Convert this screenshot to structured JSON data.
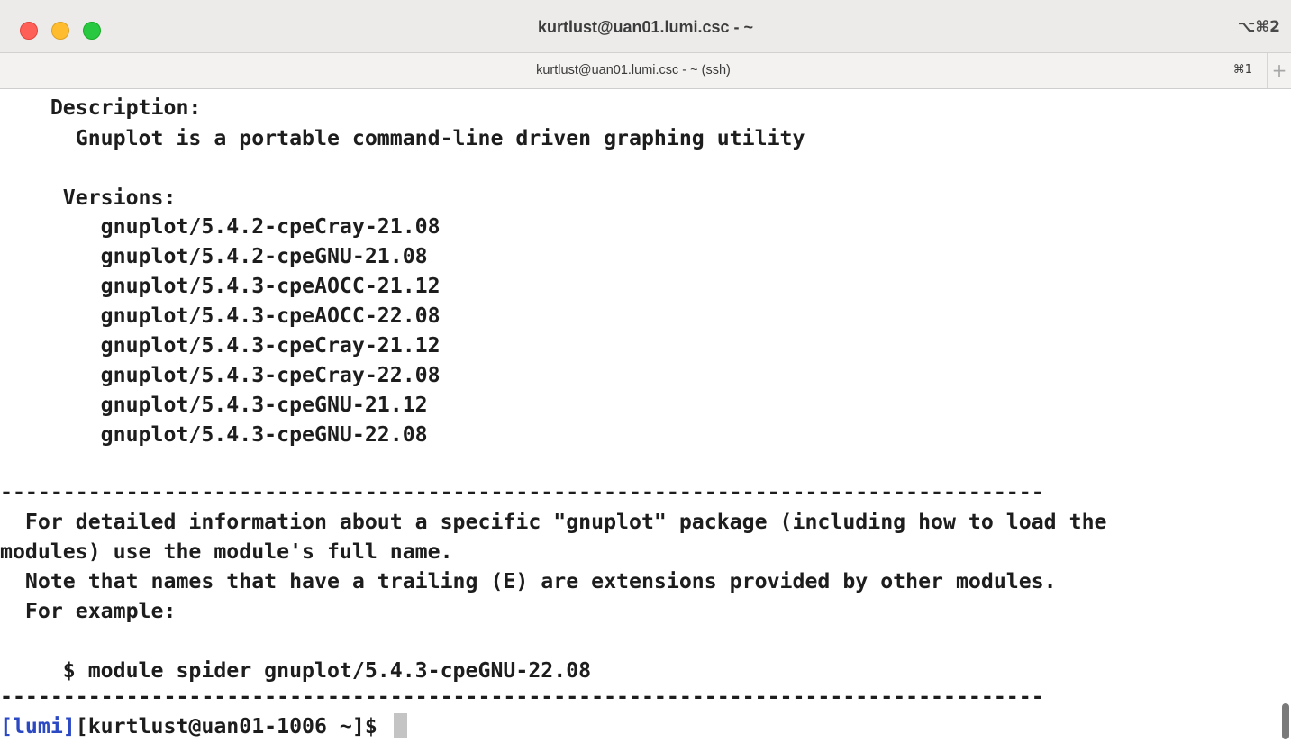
{
  "window": {
    "title": "kurtlust@uan01.lumi.csc - ~",
    "shortcut": "⌥⌘2"
  },
  "tab": {
    "title": "kurtlust@uan01.lumi.csc - ~ (ssh)",
    "shortcut": "⌘1",
    "new_tab": "+"
  },
  "terminal": {
    "description_header": "    Description:",
    "description_text": "      Gnuplot is a portable command-line driven graphing utility",
    "versions_header": "     Versions:",
    "versions": [
      "        gnuplot/5.4.2-cpeCray-21.08",
      "        gnuplot/5.4.2-cpeGNU-21.08",
      "        gnuplot/5.4.3-cpeAOCC-21.12",
      "        gnuplot/5.4.3-cpeAOCC-22.08",
      "        gnuplot/5.4.3-cpeCray-21.12",
      "        gnuplot/5.4.3-cpeCray-22.08",
      "        gnuplot/5.4.3-cpeGNU-21.12",
      "        gnuplot/5.4.3-cpeGNU-22.08"
    ],
    "separator": "-----------------------------------------------------------------------------------",
    "info_lines": [
      "  For detailed information about a specific \"gnuplot\" package (including how to load the",
      "modules) use the module's full name.",
      "  Note that names that have a trailing (E) are extensions provided by other modules.",
      "  For example:"
    ],
    "example_command": "     $ module spider gnuplot/5.4.3-cpeGNU-22.08",
    "prompt_tag": "[lumi]",
    "prompt_rest": "[kurtlust@uan01-1006 ~]$ "
  }
}
